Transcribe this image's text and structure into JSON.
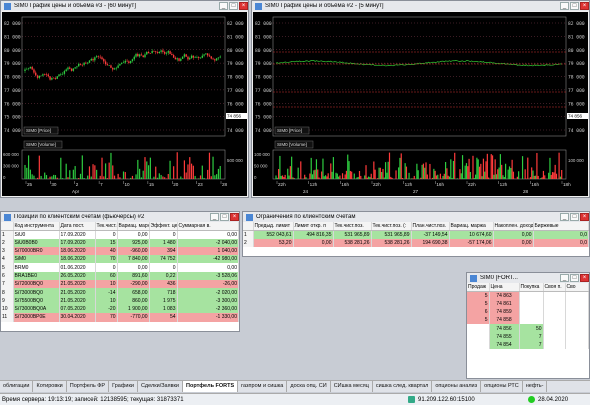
{
  "chart1": {
    "title": "SIM0 График цены и объёма #3 - [60 минут]",
    "price_label": "SIM0 [Price]",
    "volume_label": "SIM0 [Volume]",
    "price_ticks": [
      "82 000",
      "81 000",
      "80 000",
      "79 000",
      "78 000",
      "77 000",
      "76 000",
      "75 000",
      "74 000"
    ],
    "vol_ticks": [
      "600 000",
      "300 000",
      "0"
    ],
    "x_labels": [
      "25",
      "30",
      "2",
      "7",
      "10",
      "15",
      "20",
      "23",
      "28"
    ],
    "x_month": "Apr",
    "last_price": "74 856",
    "last_vol": "500 000"
  },
  "chart2": {
    "title": "SIM0 График цены и объёма #2 - [5 минут]",
    "price_label": "SIM0 [Price]",
    "volume_label": "SIM0 [Volume]",
    "price_ticks": [
      "82 000",
      "81 000",
      "80 000",
      "79 000",
      "78 000",
      "77 000",
      "76 000",
      "75 000",
      "74 000"
    ],
    "vol_ticks": [
      "100 000",
      "50 000",
      "0"
    ],
    "x_labels": [
      "22h",
      "12h",
      "16h",
      "22h",
      "12h",
      "16h",
      "22h",
      "12h",
      "16h",
      "18h"
    ],
    "x_days": [
      "24",
      "27",
      "28"
    ],
    "last_price": "74 856",
    "last_vol": "100 000"
  },
  "positions": {
    "title": "Позиции по клиентским счетам (фьючерсы) #2",
    "headers": [
      "",
      "Код инструмента",
      "Дата пост.",
      "Тек.чист.поз.",
      "Вариац. маржа",
      "Эффект. цена",
      "Суммарная в."
    ],
    "rows": [
      {
        "n": "1",
        "code": "SiU0",
        "date": "17.09.2020",
        "pos": "0",
        "vm": "0,00",
        "price": "0",
        "sum": "0,00",
        "cls": "rw"
      },
      {
        "n": "2",
        "code": "SiU0B0B0",
        "date": "17.09.2020",
        "pos": "15",
        "vm": "925,00",
        "price": "1 480",
        "sum": "-2 040,00",
        "cls": "rg"
      },
      {
        "n": "3",
        "code": "Si70000BR0",
        "date": "18.06.2020",
        "pos": "40",
        "vm": "-960,00",
        "price": "394",
        "sum": "1 040,00",
        "cls": "rr"
      },
      {
        "n": "4",
        "code": "SiM0",
        "date": "18.06.2020",
        "pos": "70",
        "vm": "7 840,00",
        "price": "74 752",
        "sum": "-42 980,00",
        "cls": "rg"
      },
      {
        "n": "5",
        "code": "BRM0",
        "date": "01.06.2020",
        "pos": "0",
        "vm": "0,00",
        "price": "0",
        "sum": "0,00",
        "cls": "rw"
      },
      {
        "n": "6",
        "code": "BRA1BE0",
        "date": "26.05.2020",
        "pos": "60",
        "vm": "891,60",
        "price": "0,22",
        "sum": "-3 528,06",
        "cls": "rg"
      },
      {
        "n": "7",
        "code": "Si72000BQ0",
        "date": "21.05.2020",
        "pos": "10",
        "vm": "-290,00",
        "price": "436",
        "sum": "-26,00",
        "cls": "rr"
      },
      {
        "n": "8",
        "code": "Si73000BQ0",
        "date": "21.05.2020",
        "pos": "-14",
        "vm": "658,00",
        "price": "718",
        "sum": "-2 020,00",
        "cls": "rg"
      },
      {
        "n": "9",
        "code": "Si75500BQ0",
        "date": "21.05.2020",
        "pos": "10",
        "vm": "860,00",
        "price": "1 975",
        "sum": "-3 300,00",
        "cls": "rg"
      },
      {
        "n": "10",
        "code": "Si73000BQ0A",
        "date": "07.05.2020",
        "pos": "-20",
        "vm": "1 900,00",
        "price": "1 083",
        "sum": "-2 360,00",
        "cls": "rg"
      },
      {
        "n": "11",
        "code": "Si73000BP0E",
        "date": "30.04.2020",
        "pos": "70",
        "vm": "-770,00",
        "price": "54",
        "sum": "-1 330,00",
        "cls": "rr"
      }
    ]
  },
  "limits": {
    "title": "Ограничения по клиентским счетам",
    "headers": [
      "",
      "Предыд. лимит",
      "Лимит откр. п",
      "Тек.чист.поз.",
      "Тек.чист.поз. (:",
      "План.чист.поз.",
      "Вариац. маржа",
      "Накоплен. доход",
      "Биржевые"
    ],
    "rows": [
      {
        "n": "1",
        "c1": "552 043,61",
        "c2": "494 816,35",
        "c3": "531 965,89",
        "c4": "531 965,89",
        "c5": "-37 149,54",
        "c6": "10 674,60",
        "c7": "0,00",
        "c8": "0,0",
        "cls": "rg"
      },
      {
        "n": "2",
        "c1": "53,20",
        "c2": "0,00",
        "c3": "538 281,26",
        "c4": "538 281,26",
        "c5": "194 690,38",
        "c6": "-57 174,06",
        "c7": "0,00",
        "c8": "0,0",
        "cls": "rr"
      }
    ]
  },
  "orderbook": {
    "title": "SIM0 [FORT...",
    "headers": [
      "Продаж",
      "Цена",
      "Покупка",
      "Своя п.",
      "Сво"
    ],
    "rows": [
      {
        "sell": "5",
        "price": "74 863",
        "buy": "",
        "cls": "rr"
      },
      {
        "sell": "5",
        "price": "74 861",
        "buy": "",
        "cls": "rr"
      },
      {
        "sell": "6",
        "price": "74 859",
        "buy": "",
        "cls": "rr"
      },
      {
        "sell": "5",
        "price": "74 858",
        "buy": "",
        "cls": "rr"
      },
      {
        "sell": "",
        "price": "74 856",
        "buy": "50",
        "cls": "rg"
      },
      {
        "sell": "",
        "price": "74 855",
        "buy": "7",
        "cls": "rg"
      },
      {
        "sell": "",
        "price": "74 854",
        "buy": "7",
        "cls": "rg"
      }
    ]
  },
  "tabs": [
    "облигации",
    "Котировки",
    "Портфель ФР",
    "Графики",
    "Сделки/Заявки",
    "Портфель FORTS",
    "газпром и сишка",
    "доска опц. СИ",
    "СИшка месяц",
    "сишка след. квартал",
    "опционы анализ",
    "опционы РТС",
    "нефть-"
  ],
  "active_tab": "Портфель FORTS",
  "status": {
    "server_time": "Время сервера: 19:13:19; записей: 12138595; текущая: 31873371",
    "ip": "91.209.122.60:15100",
    "date": "28.04.2020"
  },
  "colors": {
    "green": "#a6e3a0",
    "red": "#f4a3a3",
    "candle_up": "#2ecc40",
    "candle_down": "#ff3b3b"
  }
}
